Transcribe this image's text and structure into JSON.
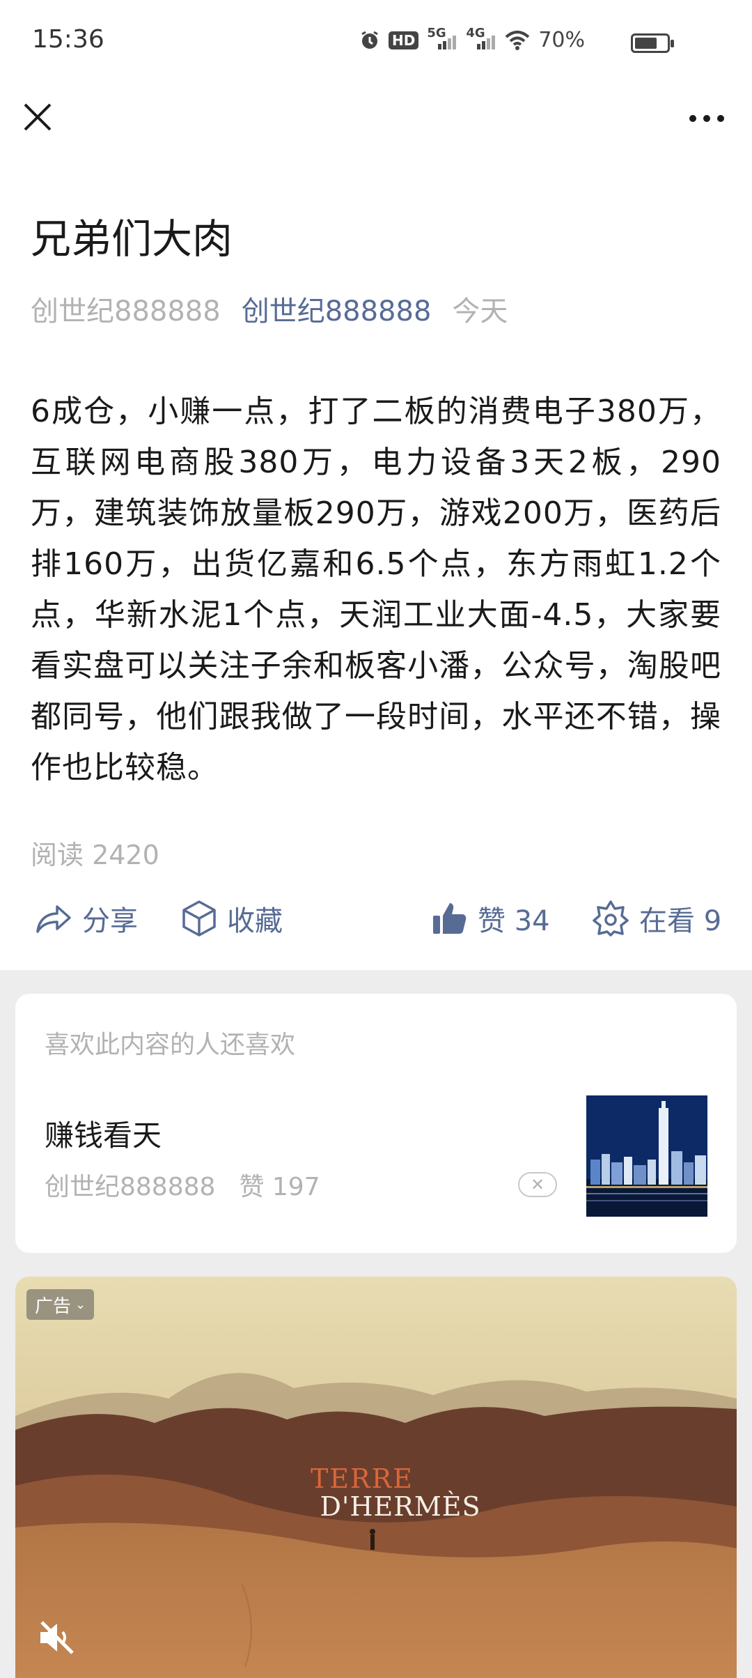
{
  "status_bar": {
    "time": "15:36",
    "icons": [
      "alarm-icon",
      "hd-icon",
      "5g-signal-icon",
      "4g-signal-icon",
      "wifi-icon",
      "battery-icon"
    ],
    "hd_label": "HD",
    "five_g_label": "5G",
    "four_g_label": "4G",
    "battery_percent_text": "70%",
    "battery_level": 0.7
  },
  "nav": {
    "close_icon": "close-icon",
    "more_icon": "more-icon"
  },
  "article": {
    "title": "兄弟们大肉",
    "author": "创世纪888888",
    "account": "创世纪888888",
    "date": "今天",
    "body": "6成仓，小赚一点，打了二板的消费电子380万，互联网电商股380万，电力设备3天2板，290万，建筑装饰放量板290万，游戏200万，医药后排160万，出货亿嘉和6.5个点，东方雨虹1.2个点，华新水泥1个点，天润工业大面-4.5，大家要看实盘可以关注子余和板客小潘，公众号，淘股吧都同号，他们跟我做了一段时间，水平还不错，操作也比较稳。",
    "read_count": "阅读 2420"
  },
  "actions": {
    "share_label": "分享",
    "favorite_label": "收藏",
    "like_label": "赞 34",
    "watching_label": "在看 9",
    "accent": "#576b95"
  },
  "recommend": {
    "heading": "喜欢此内容的人还喜欢",
    "item_title": "赚钱看天",
    "item_author": "创世纪888888",
    "item_likes": "赞 197"
  },
  "ad": {
    "tag": "广告",
    "brand_line1": "TERRE",
    "brand_line2": "D'HERMÈS"
  }
}
